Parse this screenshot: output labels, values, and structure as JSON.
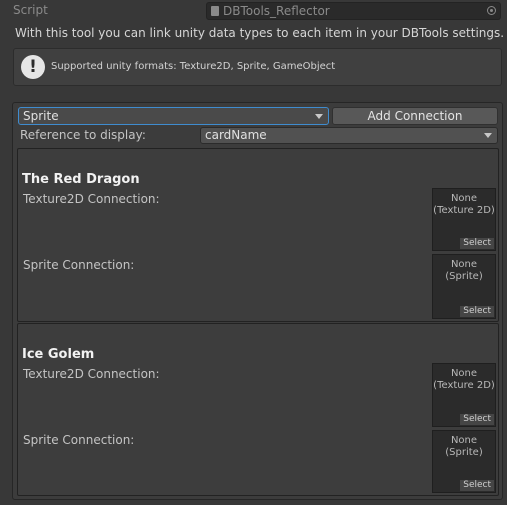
{
  "script_row": {
    "label": "Script",
    "value": "DBTools_Reflector"
  },
  "description": "With this tool you can link unity data types to each item in your DBTools settings.",
  "help_box": {
    "text": "Supported unity formats: Texture2D, Sprite, GameObject"
  },
  "toolbar": {
    "type_dropdown_value": "Sprite",
    "add_connection_label": "Add Connection",
    "reference_label": "Reference to display:",
    "reference_dropdown_value": "cardName"
  },
  "items": [
    {
      "title": "The Red Dragon",
      "texture_label": "Texture2D Connection:",
      "texture_field": {
        "line1": "None",
        "line2": "(Texture 2D)",
        "select": "Select"
      },
      "sprite_label": "Sprite Connection:",
      "sprite_field": {
        "line1": "None",
        "line2": "(Sprite)",
        "select": "Select"
      }
    },
    {
      "title": "Ice Golem",
      "texture_label": "Texture2D Connection:",
      "texture_field": {
        "line1": "None",
        "line2": "(Texture 2D)",
        "select": "Select"
      },
      "sprite_label": "Sprite Connection:",
      "sprite_field": {
        "line1": "None",
        "line2": "(Sprite)",
        "select": "Select"
      }
    }
  ],
  "colors": {
    "background": "#383838",
    "focus_outline": "#3f8ccf"
  }
}
